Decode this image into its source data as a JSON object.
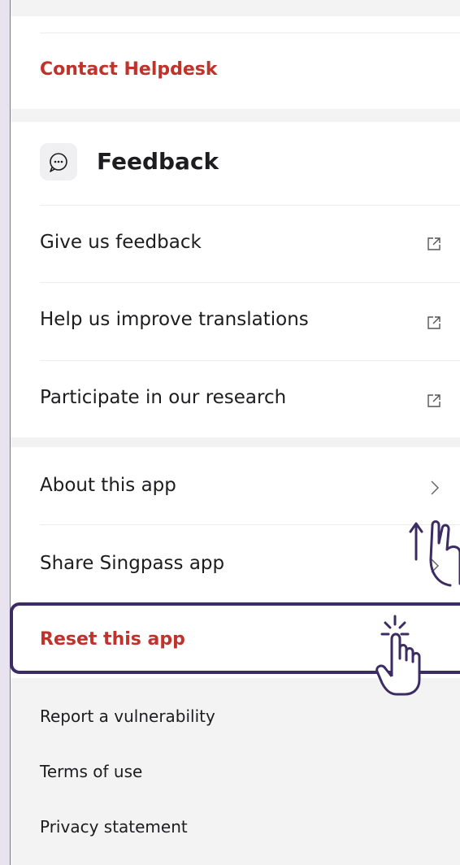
{
  "helpdesk": {
    "label": "Contact Helpdesk"
  },
  "feedback": {
    "title": "Feedback",
    "icon": "chat-bubble-icon",
    "items": [
      {
        "label": "Give us feedback",
        "icon": "external-link-icon"
      },
      {
        "label": "Help us improve translations",
        "icon": "external-link-icon"
      },
      {
        "label": "Participate in our research",
        "icon": "external-link-icon"
      }
    ]
  },
  "app_section": {
    "items": [
      {
        "label": "About this app",
        "icon": "chevron-right-icon"
      },
      {
        "label": "Share Singpass app",
        "icon": "chevron-right-icon"
      },
      {
        "label": "Reset this app"
      }
    ]
  },
  "footer_links": [
    {
      "label": "Report a vulnerability"
    },
    {
      "label": "Terms of use"
    },
    {
      "label": "Privacy statement"
    }
  ],
  "colors": {
    "accent_red": "#c0332b",
    "highlight_purple": "#3d2b63"
  }
}
